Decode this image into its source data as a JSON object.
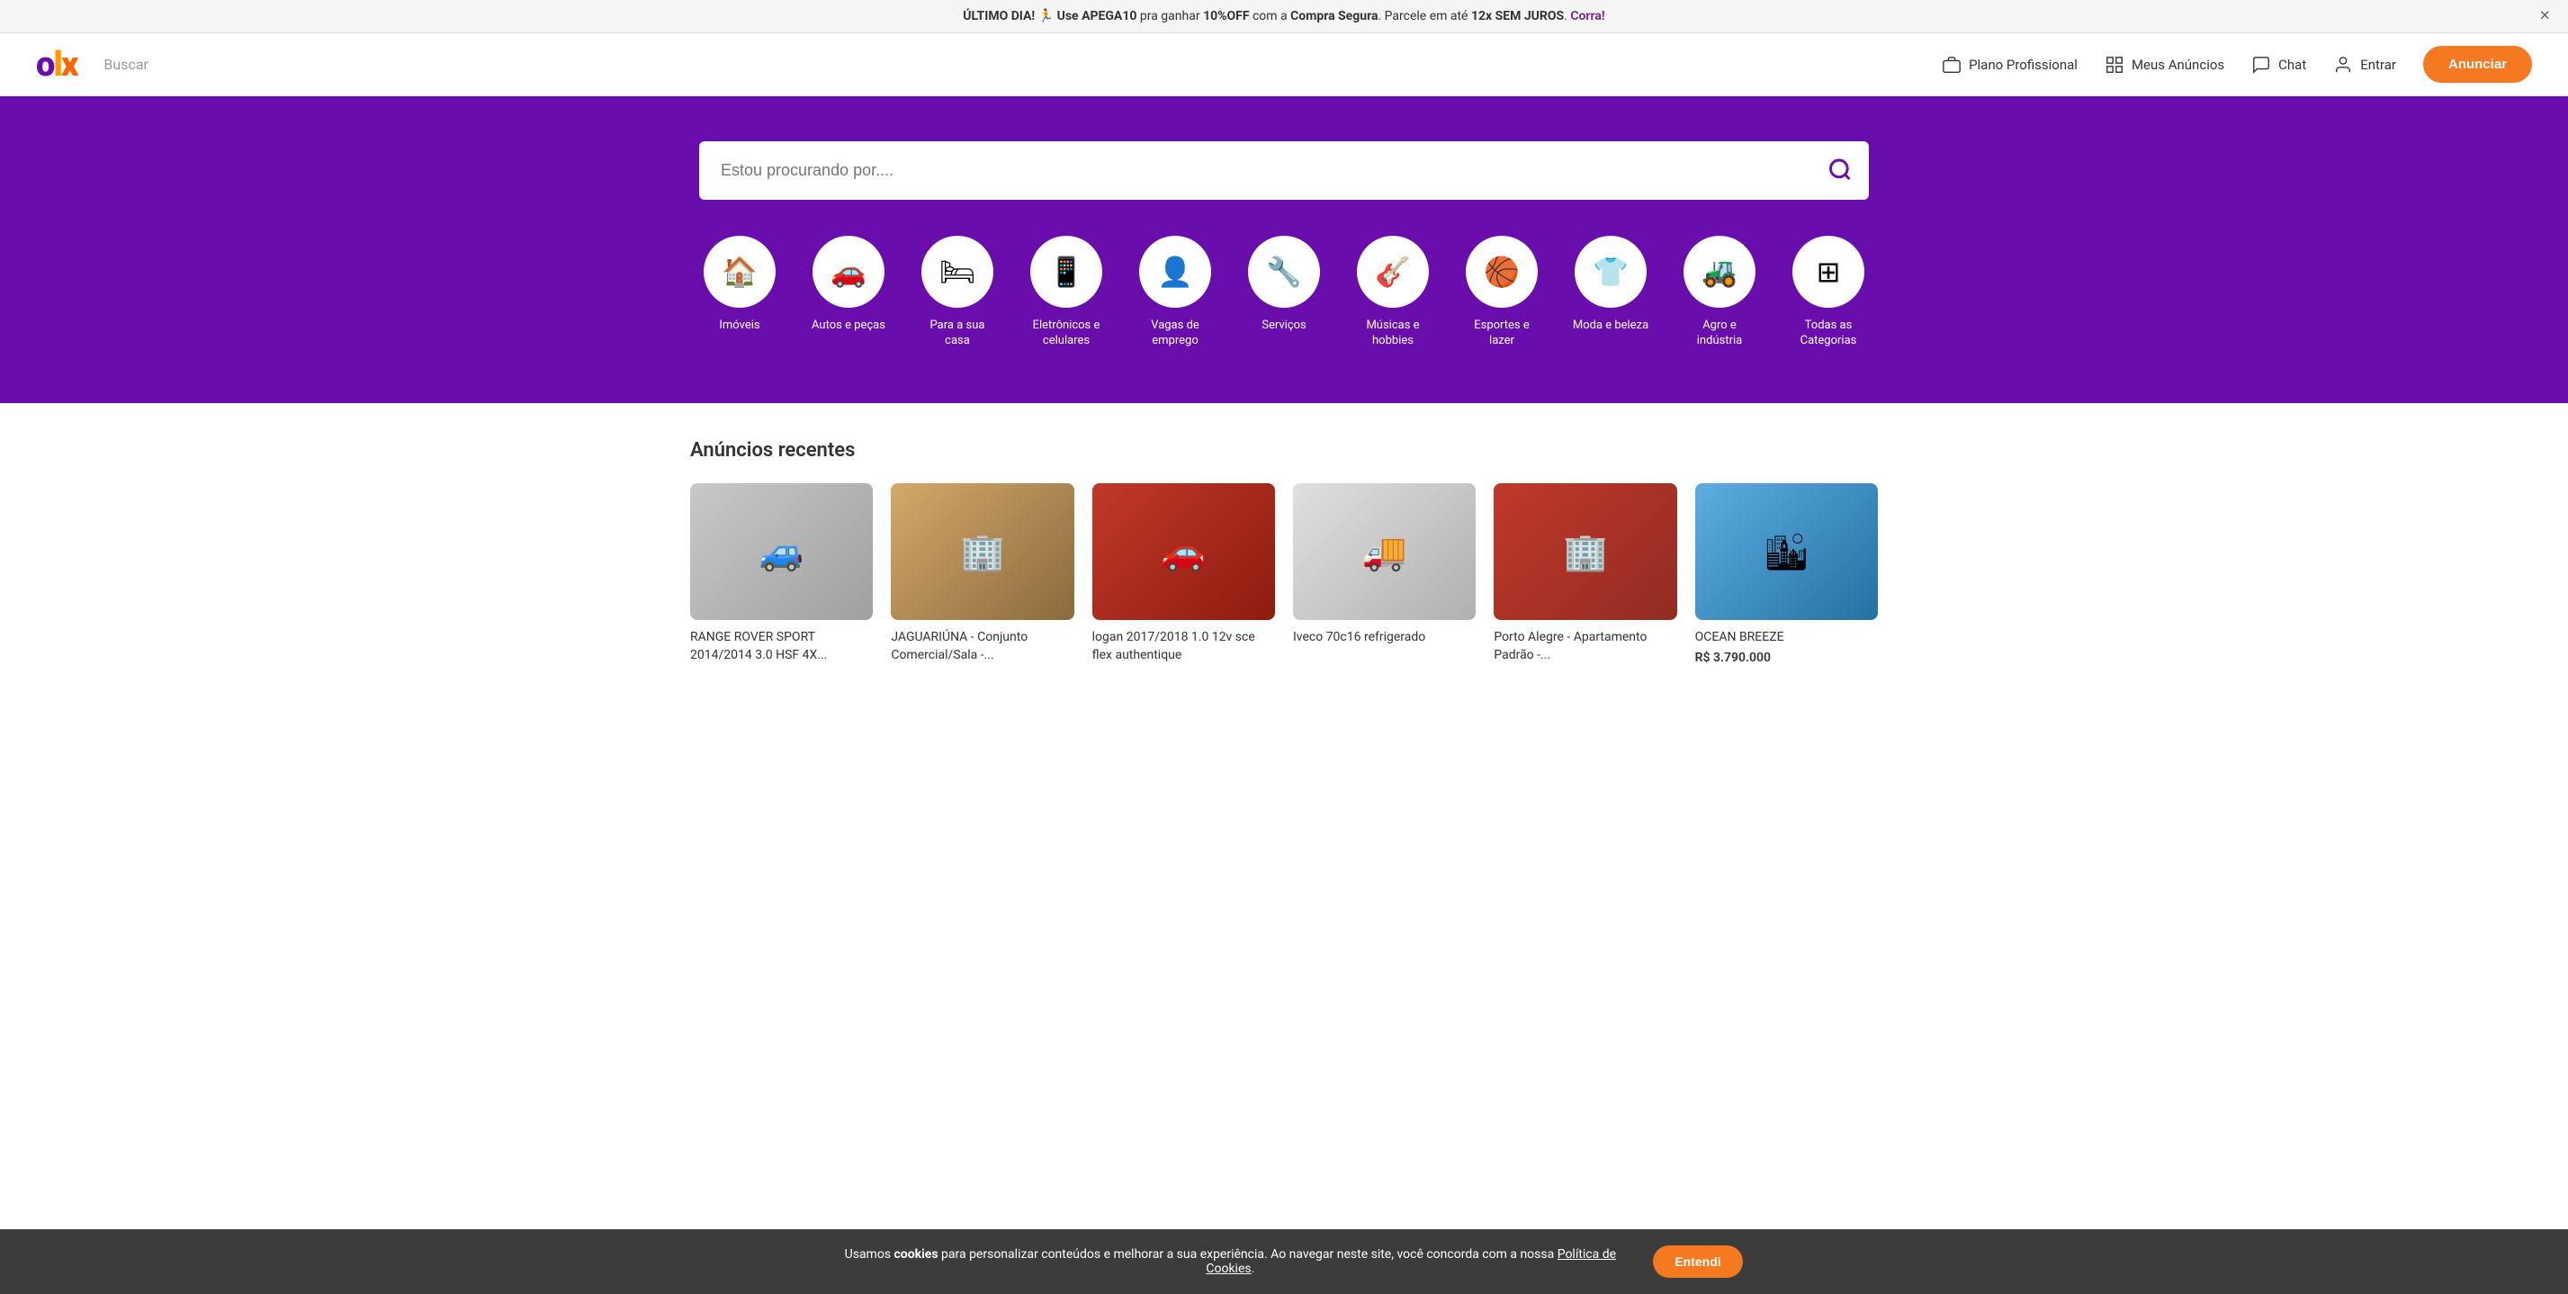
{
  "banner": {
    "text_prefix": "ÚLTIMO DIA! 🏃 Use ",
    "code": "APEGA10",
    "text_mid": " pra ganhar ",
    "discount": "10%OFF",
    "text_mid2": " com a ",
    "brand": "Compra Segura",
    "text_suffix": ". Parcele em até ",
    "installment": "12x SEM JUROS",
    "text_end": ". ",
    "cta": "Corra!",
    "close_label": "×"
  },
  "header": {
    "logo": "OLX",
    "search_label": "Buscar",
    "nav": {
      "plano": "Plano Profissional",
      "anuncios": "Meus Anúncios",
      "chat": "Chat",
      "entrar": "Entrar",
      "anunciar": "Anunciar"
    }
  },
  "hero": {
    "search_placeholder": "Estou procurando por...."
  },
  "categories": [
    {
      "id": "imoveis",
      "label": "Imóveis",
      "icon": "🏠"
    },
    {
      "id": "autos",
      "label": "Autos e peças",
      "icon": "🚗"
    },
    {
      "id": "casa",
      "label": "Para a sua casa",
      "icon": "🛏"
    },
    {
      "id": "eletronicos",
      "label": "Eletrônicos e celulares",
      "icon": "📱"
    },
    {
      "id": "vagas",
      "label": "Vagas de emprego",
      "icon": "👤"
    },
    {
      "id": "servicos",
      "label": "Serviços",
      "icon": "🔧"
    },
    {
      "id": "musicas",
      "label": "Músicas e hobbies",
      "icon": "🎸"
    },
    {
      "id": "esportes",
      "label": "Esportes e lazer",
      "icon": "🏀"
    },
    {
      "id": "moda",
      "label": "Moda e beleza",
      "icon": "👕"
    },
    {
      "id": "agro",
      "label": "Agro e indústria",
      "icon": "🚜"
    },
    {
      "id": "todas",
      "label": "Todas as Categorias",
      "icon": "⊞"
    }
  ],
  "recent": {
    "title": "Anúncios recentes",
    "listings": [
      {
        "id": 1,
        "title": "RANGE ROVER SPORT 2014/2014 3.0 HSF 4X...",
        "price": "",
        "img_class": "car-img-1",
        "emoji": "🚙"
      },
      {
        "id": 2,
        "title": "JAGUARIÚNA - Conjunto Comercial/Sala -...",
        "price": "",
        "img_class": "car-img-2",
        "emoji": "🏢"
      },
      {
        "id": 3,
        "title": "logan 2017/2018 1.0 12v sce flex authentique",
        "price": "",
        "img_class": "car-img-3",
        "emoji": "🚗"
      },
      {
        "id": 4,
        "title": "Iveco 70c16 refrigerado",
        "price": "",
        "img_class": "car-img-4",
        "emoji": "🚚"
      },
      {
        "id": 5,
        "title": "Porto Alegre - Apartamento Padrão -...",
        "price": "",
        "img_class": "car-img-5",
        "emoji": "🏢"
      },
      {
        "id": 6,
        "title": "OCEAN BREEZE",
        "price": "R$ 3.790.000",
        "img_class": "car-img-6",
        "emoji": "🏙"
      }
    ]
  },
  "cookie": {
    "text_prefix": "Usamos ",
    "cookies": "cookies",
    "text_mid": " para personalizar conteúdos e melhorar a sua experiência. Ao navegar neste site, você concorda com a nossa ",
    "link": "Política de Cookies",
    "text_suffix": ".",
    "btn": "Entendi"
  }
}
